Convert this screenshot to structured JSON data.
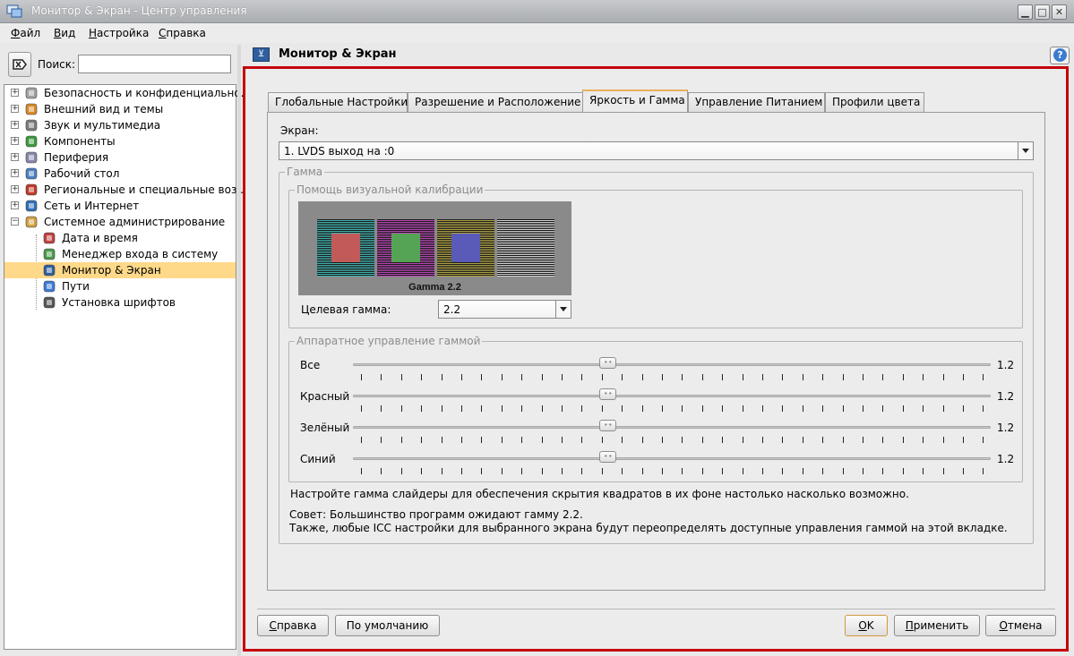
{
  "window": {
    "title": "Монитор & Экран - Центр управления",
    "minimize": "▁",
    "maximize": "□",
    "close": "✕"
  },
  "menu": [
    {
      "key": "Ф",
      "rest": "айл"
    },
    {
      "key": "В",
      "rest": "ид"
    },
    {
      "key": "Н",
      "rest": "астройка"
    },
    {
      "key": "С",
      "rest": "правка"
    }
  ],
  "search": {
    "label": "Поиск:",
    "value": "",
    "placeholder": ""
  },
  "tree": [
    {
      "label": "Безопасность и конфиденциально...",
      "expander": "+",
      "icon": "keys-icon"
    },
    {
      "label": "Внешний вид и темы",
      "expander": "+",
      "icon": "paintbrush-icon"
    },
    {
      "label": "Звук и мультимедиа",
      "expander": "+",
      "icon": "speaker-icon"
    },
    {
      "label": "Компоненты",
      "expander": "+",
      "icon": "components-icon"
    },
    {
      "label": "Периферия",
      "expander": "+",
      "icon": "mouse-icon"
    },
    {
      "label": "Рабочий стол",
      "expander": "+",
      "icon": "desktop-icon"
    },
    {
      "label": "Региональные и специальные воз...",
      "expander": "+",
      "icon": "flag-icon"
    },
    {
      "label": "Сеть и Интернет",
      "expander": "+",
      "icon": "globe-icon"
    },
    {
      "label": "Системное администрирование",
      "expander": "−",
      "icon": "gears-icon"
    },
    {
      "label": "Дата и время",
      "icon": "clock-icon"
    },
    {
      "label": "Менеджер входа в систему",
      "icon": "login-icon"
    },
    {
      "label": "Монитор & Экран",
      "icon": "monitor-icon",
      "selected": true
    },
    {
      "label": "Пути",
      "icon": "cube-icon"
    },
    {
      "label": "Установка шрифтов",
      "icon": "font-icon"
    }
  ],
  "module": {
    "title": "Монитор & Экран",
    "help": "?"
  },
  "tabs": [
    {
      "label": "Глобальные Настройки"
    },
    {
      "label": "Разрешение и Расположение"
    },
    {
      "label": "Яркость и Гамма",
      "active": true
    },
    {
      "label": "Управление Питанием"
    },
    {
      "label": "Профили цвета"
    }
  ],
  "screen": {
    "label": "Экран:",
    "value": "1. LVDS выход на :0"
  },
  "gamma_group": {
    "title": "Гамма"
  },
  "calibration": {
    "title": "Помощь визуальной калибрации",
    "caption": "Gamma 2.2",
    "target_label": "Целевая гамма:",
    "target_value": "2.2",
    "squares": [
      {
        "outer": "#3fb4b0",
        "inner": "#c25a5a"
      },
      {
        "outer": "#b747b5",
        "inner": "#55a455"
      },
      {
        "outer": "#b0a445",
        "inner": "#5a5ab8"
      },
      {
        "outer": "#111111",
        "inner": "#111111"
      }
    ]
  },
  "hardware": {
    "title": "Аппаратное управление гаммой",
    "sliders": [
      {
        "name": "Все",
        "value": "1.2",
        "level": 0.4
      },
      {
        "name": "Красный",
        "value": "1.2",
        "level": 0.4
      },
      {
        "name": "Зелёный",
        "value": "1.2",
        "level": 0.4
      },
      {
        "name": "Синий",
        "value": "1.2",
        "level": 0.4
      }
    ]
  },
  "hint": "Настройте гамма слайдеры для обеспечения скрытия квадратов в их фоне настолько насколько возможно.",
  "tip1": "Совет: Большинство программ ожидают гамму 2.2.",
  "tip2": "Также, любые ICC настройки для выбранного экрана будут переопределять доступные управления гаммой на этой вкладке.",
  "buttons": {
    "help": {
      "key": "С",
      "rest": "правка"
    },
    "defaults": "По умолчанию",
    "ok": {
      "key": "O",
      "rest": "K"
    },
    "apply": {
      "key": "П",
      "rest": "рименить"
    },
    "cancel": {
      "key": "О",
      "rest": "тмена"
    }
  }
}
